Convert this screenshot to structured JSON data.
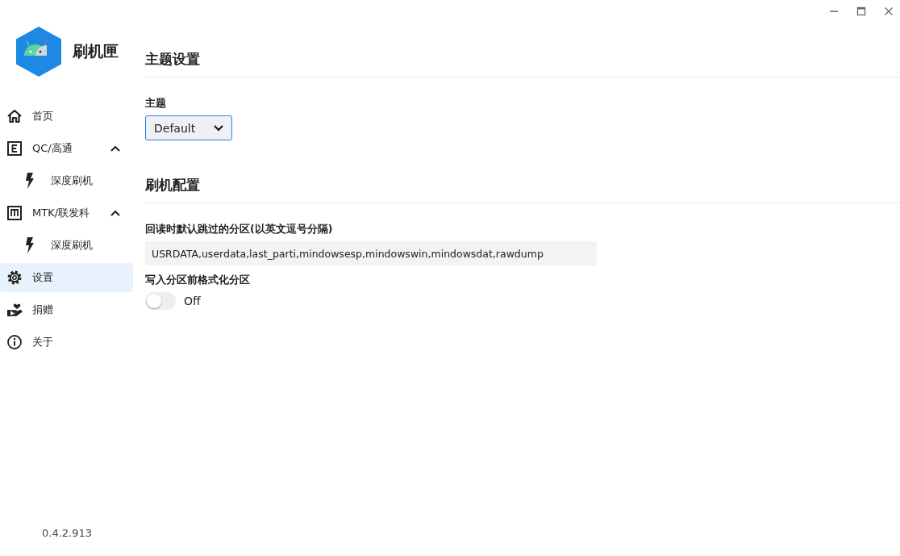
{
  "app": {
    "name": "刷机匣",
    "version": "0.4.2.913"
  },
  "sidebar": {
    "items": [
      {
        "label": "首页",
        "selected": false
      },
      {
        "label": "QC/高通",
        "selected": false,
        "expanded": true,
        "children": [
          {
            "label": "深度刷机",
            "selected": false
          }
        ]
      },
      {
        "label": "MTK/联发科",
        "selected": false,
        "expanded": true,
        "children": [
          {
            "label": "深度刷机",
            "selected": false
          }
        ]
      },
      {
        "label": "设置",
        "selected": true
      },
      {
        "label": "捐赠",
        "selected": false
      },
      {
        "label": "关于",
        "selected": false
      }
    ]
  },
  "sections": [
    {
      "title": "主题设置",
      "fields": [
        {
          "kind": "select",
          "label": "主题",
          "value": "Default"
        }
      ]
    },
    {
      "title": "刷机配置",
      "fields": [
        {
          "kind": "text",
          "label": "回读时默认跳过的分区(以英文逗号分隔)",
          "value": "USRDATA,userdata,last_parti,mindowsesp,mindowswin,mindowsdat,rawdump"
        },
        {
          "kind": "switch",
          "label": "写入分区前格式化分区",
          "on": false,
          "state_label": "Off"
        }
      ]
    }
  ]
}
